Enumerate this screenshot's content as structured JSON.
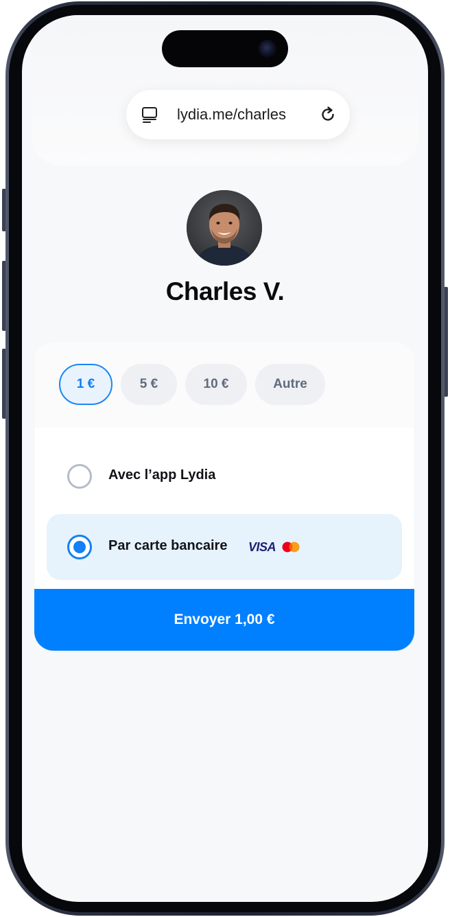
{
  "browser": {
    "url": "lydia.me/charles",
    "icons": {
      "reader": "reader-mode-icon",
      "reload": "reload-icon"
    }
  },
  "profile": {
    "name": "Charles V.",
    "avatar": "avatar-photo"
  },
  "amounts": {
    "options": [
      "1 €",
      "5 €",
      "10 €",
      "Autre"
    ],
    "selected": "1 €"
  },
  "payment_methods": [
    {
      "label": "Avec l’app Lydia",
      "selected": false
    },
    {
      "label": "Par carte bancaire",
      "selected": true,
      "brand": "VISA",
      "brand_icons": [
        "visa-logo",
        "mastercard-logo"
      ]
    }
  ],
  "send_button": {
    "label": "Envoyer 1,00 €"
  },
  "colors": {
    "accent": "#0080ff",
    "selected_bg": "#e6f2fc",
    "chip_bg": "#eef0f3",
    "screen_bg": "#f7f8fa"
  }
}
